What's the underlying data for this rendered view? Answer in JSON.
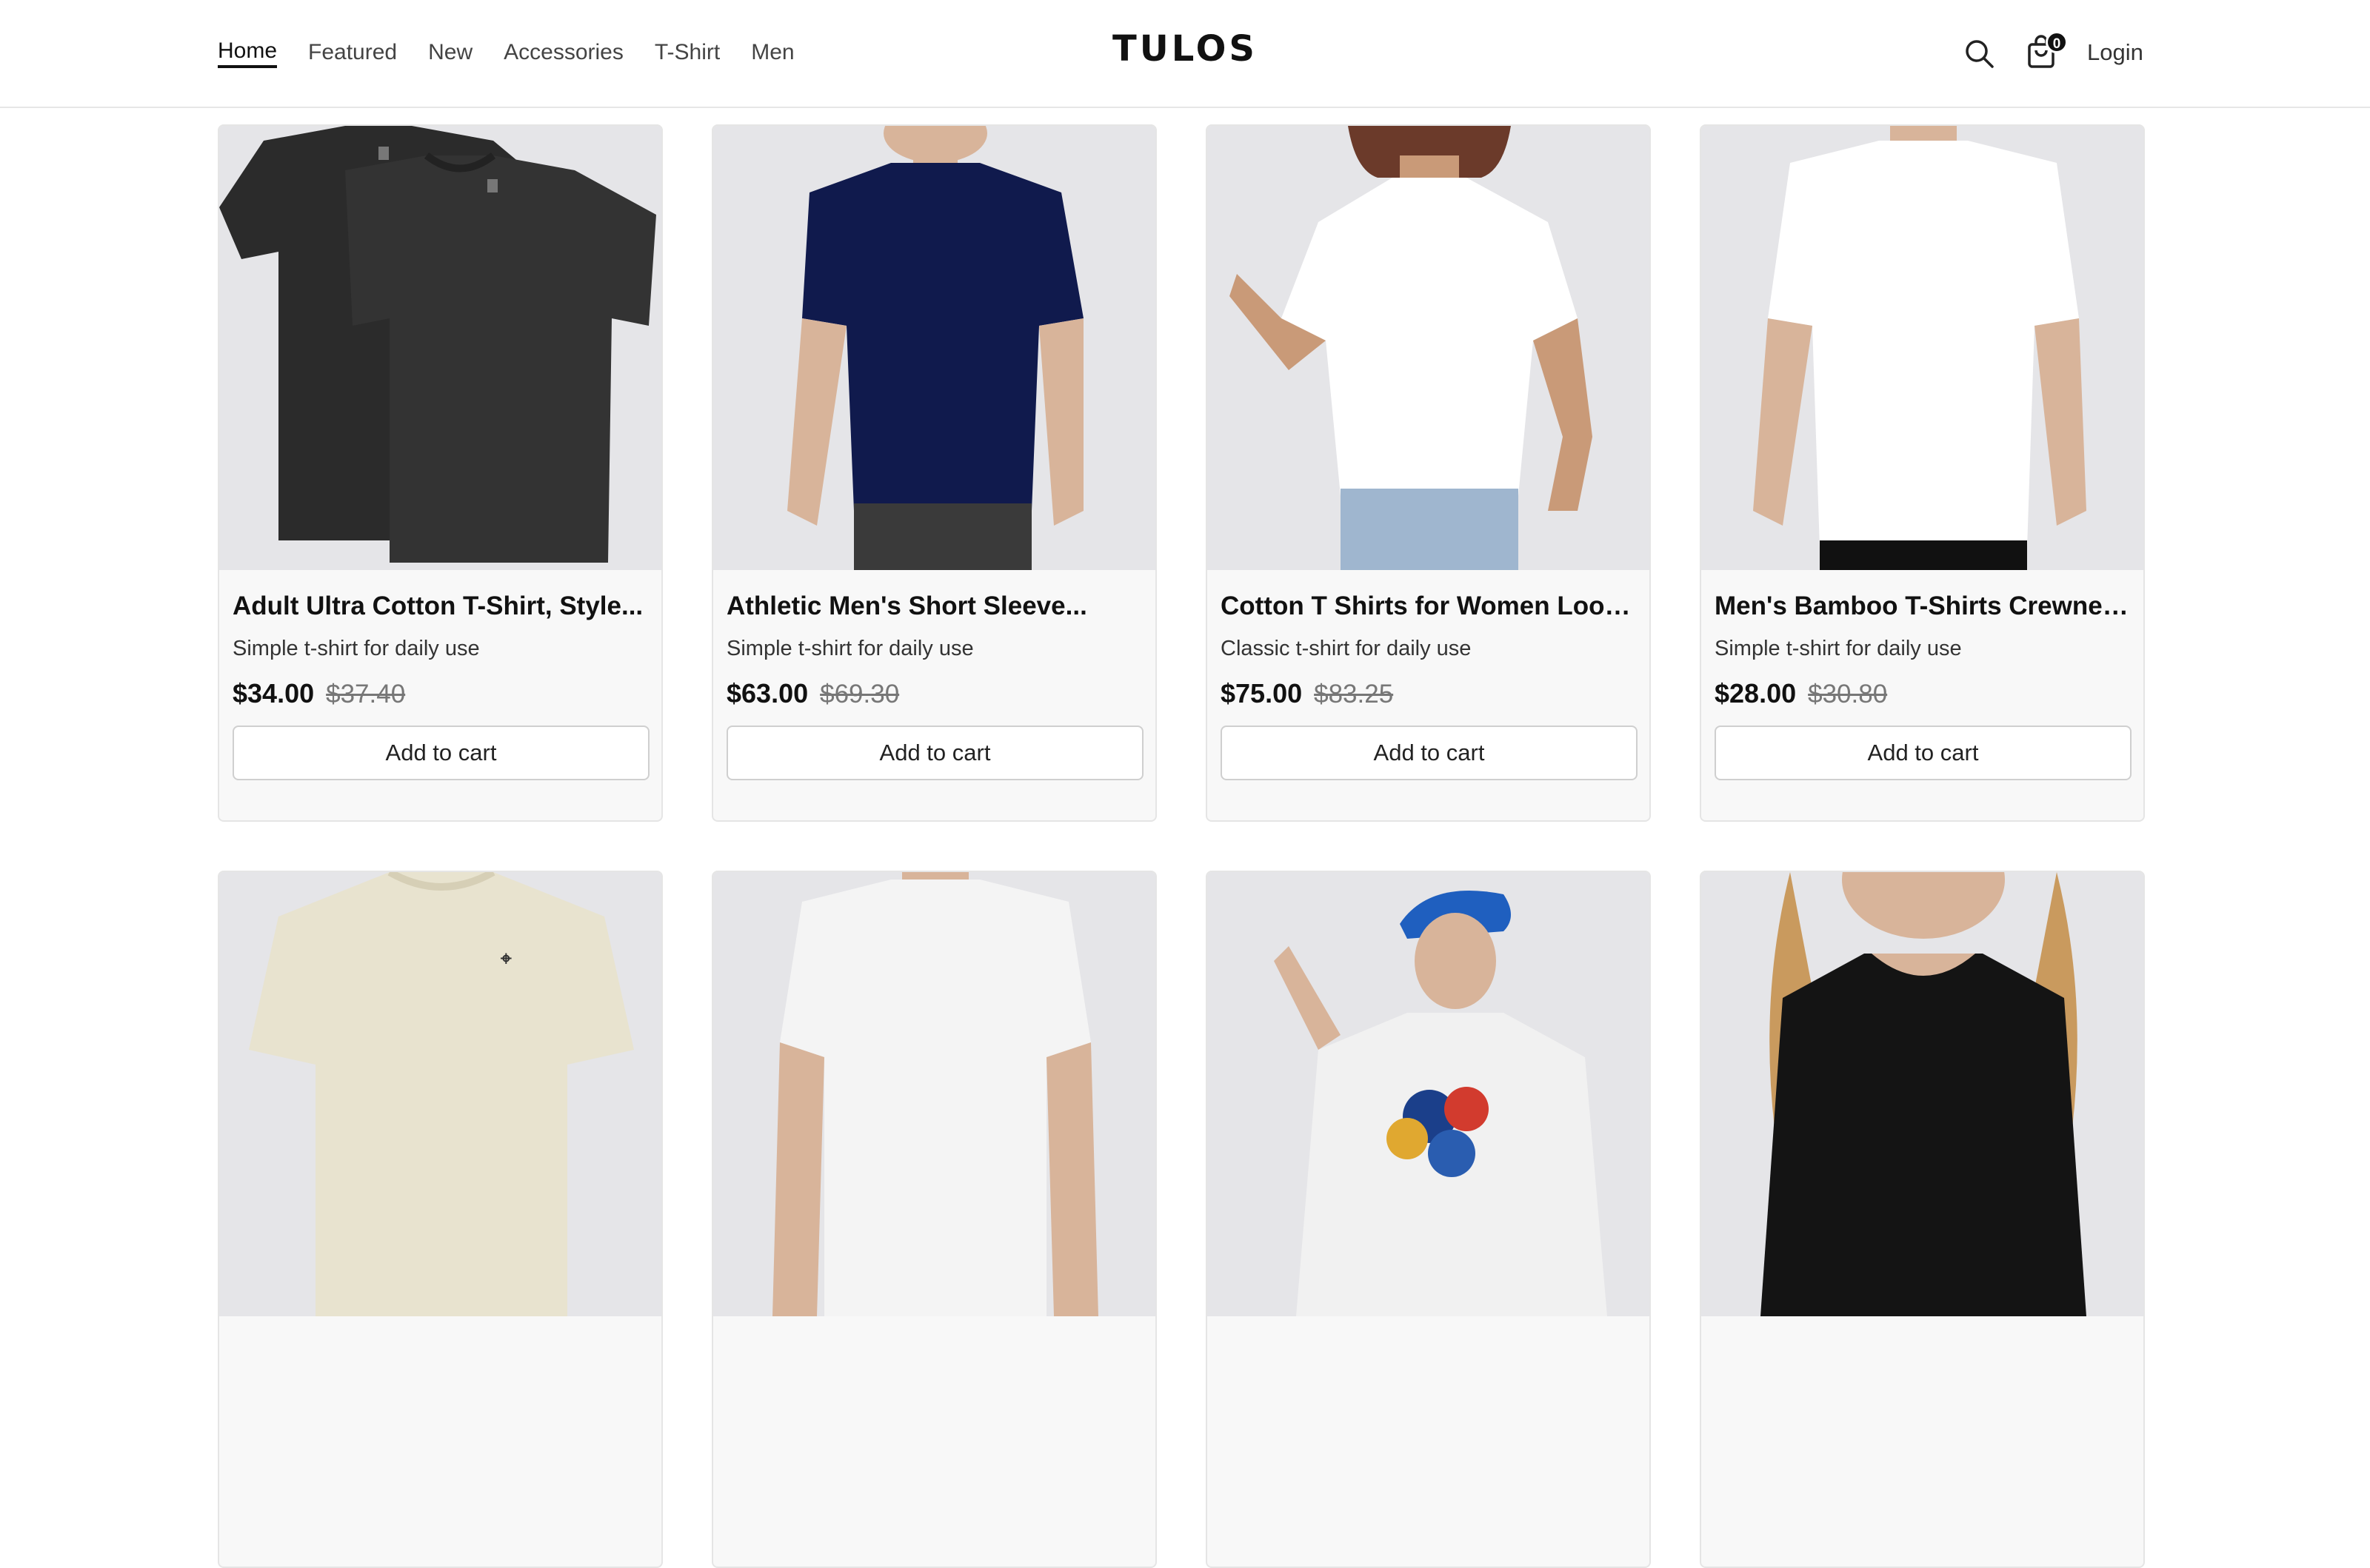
{
  "nav": {
    "items": [
      {
        "label": "Home",
        "active": true
      },
      {
        "label": "Featured",
        "active": false
      },
      {
        "label": "New",
        "active": false
      },
      {
        "label": "Accessories",
        "active": false
      },
      {
        "label": "T-Shirt",
        "active": false
      },
      {
        "label": "Men",
        "active": false
      }
    ]
  },
  "brand": {
    "logo": "TULOS"
  },
  "header_actions": {
    "search_icon": "search-icon",
    "cart_icon": "shopping-bag-icon",
    "cart_count": "0",
    "login_label": "Login"
  },
  "colors": {
    "accent": "#111111",
    "card_bg": "#f8f8f8",
    "image_bg": "#e5e5e8",
    "border": "#e5e5e5"
  },
  "products": [
    {
      "title": "Adult Ultra Cotton T-Shirt, Style...",
      "description": "Simple t-shirt for daily use",
      "price": "$34.00",
      "old_price": "$37.40",
      "button": "Add to cart",
      "image": "black-tshirt-pair"
    },
    {
      "title": "Athletic Men's Short Sleeve...",
      "description": "Simple t-shirt for daily use",
      "price": "$63.00",
      "old_price": "$69.30",
      "button": "Add to cart",
      "image": "man-navy-tshirt"
    },
    {
      "title": "Cotton T Shirts for Women Loose...",
      "description": "Classic t-shirt for daily use",
      "price": "$75.00",
      "old_price": "$83.25",
      "button": "Add to cart",
      "image": "woman-white-tshirt"
    },
    {
      "title": "Men's Bamboo T-Shirts Crewneck...",
      "description": "Simple t-shirt for daily use",
      "price": "$28.00",
      "old_price": "$30.80",
      "button": "Add to cart",
      "image": "man-white-tshirt"
    },
    {
      "title": "",
      "description": "",
      "price": "",
      "old_price": "",
      "button": "",
      "image": "beige-tshirt"
    },
    {
      "title": "",
      "description": "",
      "price": "",
      "old_price": "",
      "button": "",
      "image": "white-tshirt-model"
    },
    {
      "title": "",
      "description": "",
      "price": "",
      "old_price": "",
      "button": "",
      "image": "woman-blue-cap-graphic-tee"
    },
    {
      "title": "",
      "description": "",
      "price": "",
      "old_price": "",
      "button": "",
      "image": "woman-black-longsleeve"
    }
  ]
}
